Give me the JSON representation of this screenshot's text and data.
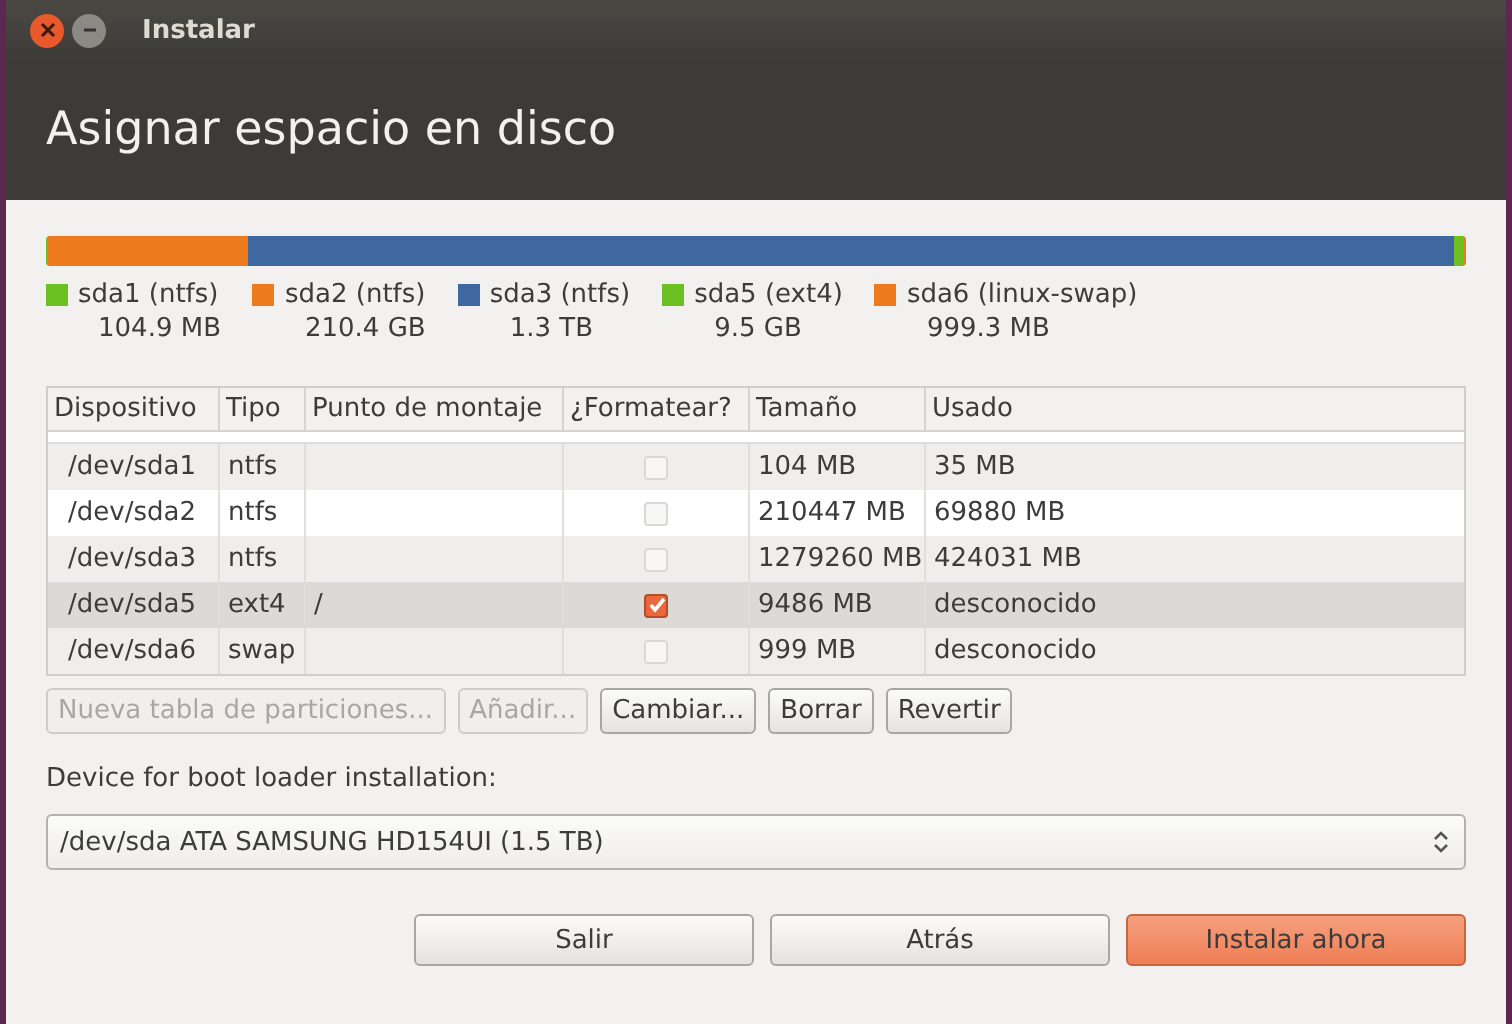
{
  "window": {
    "title": "Instalar"
  },
  "header": {
    "title": "Asignar espacio en disco"
  },
  "disk_bar": [
    {
      "color": "#6cc021",
      "level": 0.002
    },
    {
      "color": "#ee7a1e",
      "level": 0.14
    },
    {
      "color": "#3f67a0",
      "level": 0.85
    },
    {
      "color": "#6cc021",
      "level": 0.006
    },
    {
      "color": "#ee7a1e",
      "level": 0.002
    }
  ],
  "partitions": [
    {
      "name": "sda1 (ntfs)",
      "size": "104.9 MB",
      "color": "#6cc021"
    },
    {
      "name": "sda2 (ntfs)",
      "size": "210.4 GB",
      "color": "#ee7a1e"
    },
    {
      "name": "sda3 (ntfs)",
      "size": "1.3 TB",
      "color": "#3f67a0"
    },
    {
      "name": "sda5 (ext4)",
      "size": "9.5 GB",
      "color": "#6cc021"
    },
    {
      "name": "sda6 (linux-swap)",
      "size": "999.3 MB",
      "color": "#ee7a1e"
    }
  ],
  "table": {
    "columns": [
      "Dispositivo",
      "Tipo",
      "Punto de montaje",
      "¿Formatear?",
      "Tamaño",
      "Usado"
    ],
    "rows": [
      {
        "device": "/dev/sda1",
        "type": "ntfs",
        "mount": "",
        "format": false,
        "size": "104 MB",
        "used": "35 MB",
        "selected": false
      },
      {
        "device": "/dev/sda2",
        "type": "ntfs",
        "mount": "",
        "format": false,
        "size": "210447 MB",
        "used": "69880 MB",
        "selected": false
      },
      {
        "device": "/dev/sda3",
        "type": "ntfs",
        "mount": "",
        "format": false,
        "size": "1279260 MB",
        "used": "424031 MB",
        "selected": false
      },
      {
        "device": "/dev/sda5",
        "type": "ext4",
        "mount": "/",
        "format": true,
        "size": "9486 MB",
        "used": "desconocido",
        "selected": true
      },
      {
        "device": "/dev/sda6",
        "type": "swap",
        "mount": "",
        "format": false,
        "size": "999 MB",
        "used": "desconocido",
        "selected": false
      }
    ]
  },
  "table_buttons": [
    {
      "label": "Nueva tabla de particiones...",
      "disabled": true
    },
    {
      "label": "Añadir...",
      "disabled": true
    },
    {
      "label": "Cambiar...",
      "disabled": false
    },
    {
      "label": "Borrar",
      "disabled": false
    },
    {
      "label": "Revertir",
      "disabled": false
    }
  ],
  "bootloader": {
    "label": "Device for boot loader installation:",
    "value": "/dev/sda ATA SAMSUNG HD154UI (1.5 TB)"
  },
  "buttons": [
    {
      "label": "Salir",
      "kind": "normal"
    },
    {
      "label": "Atrás",
      "kind": "normal"
    },
    {
      "label": "Instalar ahora",
      "kind": "primary"
    }
  ]
}
